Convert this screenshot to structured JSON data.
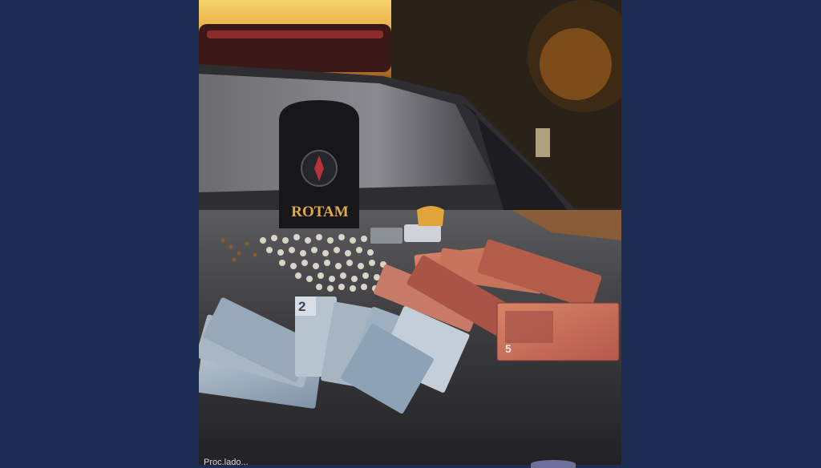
{
  "photo": {
    "patch_text": "ROTAM",
    "banknote_denominations": [
      "2",
      "5"
    ],
    "caption_partial": "Proc.lado..."
  },
  "colors": {
    "page_background": "#1c2c52",
    "patch_text": "#e0a94a",
    "sky": "#f2c04a"
  }
}
